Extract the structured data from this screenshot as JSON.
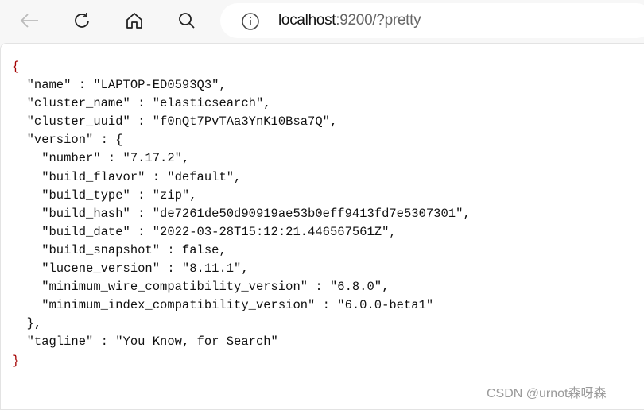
{
  "browser": {
    "url_host": "localhost",
    "url_rest": ":9200/?pretty",
    "icons": [
      "back-icon",
      "refresh-icon",
      "home-icon",
      "search-icon",
      "info-icon"
    ]
  },
  "document": {
    "lines": [
      "{",
      "  \"name\" : \"LAPTOP-ED0593Q3\",",
      "  \"cluster_name\" : \"elasticsearch\",",
      "  \"cluster_uuid\" : \"f0nQt7PvTAa3YnK10Bsa7Q\",",
      "  \"version\" : {",
      "    \"number\" : \"7.17.2\",",
      "    \"build_flavor\" : \"default\",",
      "    \"build_type\" : \"zip\",",
      "    \"build_hash\" : \"de7261de50d90919ae53b0eff9413fd7e5307301\",",
      "    \"build_date\" : \"2022-03-28T15:12:21.446567561Z\",",
      "    \"build_snapshot\" : false,",
      "    \"lucene_version\" : \"8.11.1\",",
      "    \"minimum_wire_compatibility_version\" : \"6.8.0\",",
      "    \"minimum_index_compatibility_version\" : \"6.0.0-beta1\"",
      "  },",
      "  \"tagline\" : \"You Know, for Search\"",
      "}"
    ]
  },
  "watermark": "CSDN @urnot森呀森"
}
